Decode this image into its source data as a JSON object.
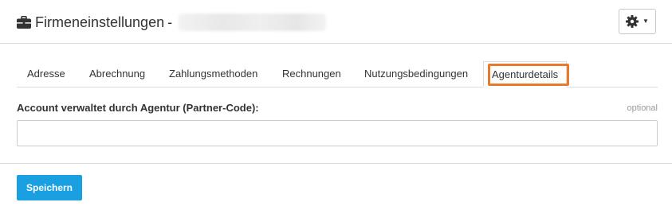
{
  "header": {
    "title": "Firmeneinstellungen",
    "separator": "-",
    "company_name_blurred": "",
    "icons": {
      "title_icon": "briefcase-icon",
      "settings_icon": "gear-icon",
      "caret_icon": "caret-down-icon"
    }
  },
  "tabs": [
    {
      "label": "Adresse",
      "active": false
    },
    {
      "label": "Abrechnung",
      "active": false
    },
    {
      "label": "Zahlungsmethoden",
      "active": false
    },
    {
      "label": "Rechnungen",
      "active": false
    },
    {
      "label": "Nutzungsbedingungen",
      "active": false
    },
    {
      "label": "Agenturdetails",
      "active": true
    }
  ],
  "form": {
    "label": "Account verwaltet durch Agentur (Partner-Code):",
    "optional": "optional",
    "value": "",
    "placeholder": ""
  },
  "footer": {
    "save_label": "Speichern"
  },
  "colors": {
    "primary": "#1aa0e0",
    "highlight": "#e8792d",
    "border": "#dddddd",
    "muted_text": "#999999"
  }
}
